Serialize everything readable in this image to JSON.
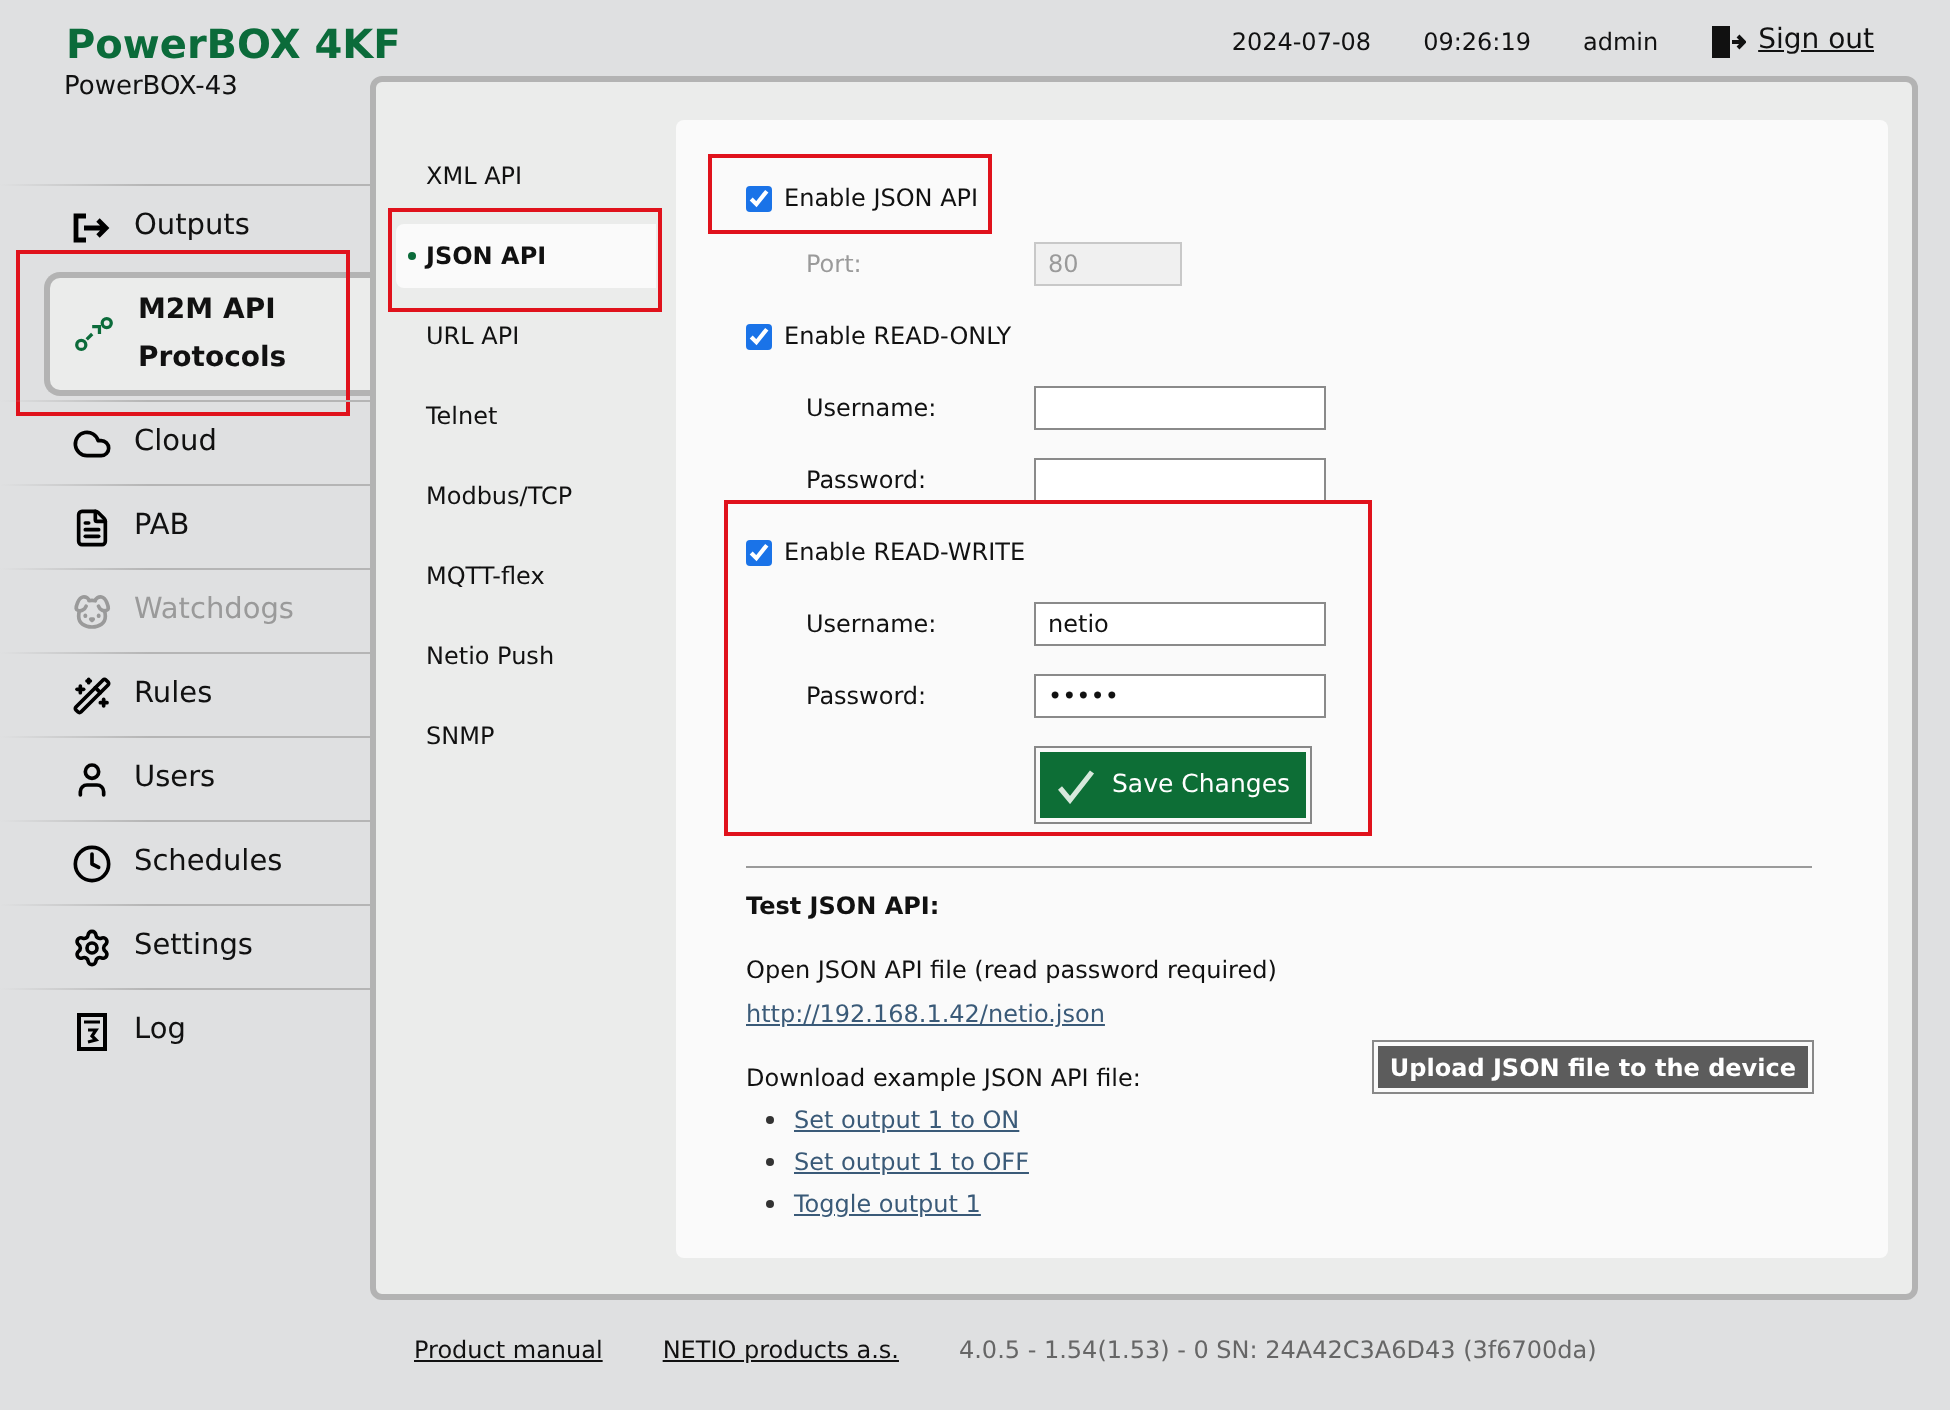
{
  "header": {
    "title": "PowerBOX 4KF",
    "subtitle": "PowerBOX-43",
    "date": "2024-07-08",
    "time": "09:26:19",
    "user": "admin",
    "sign_out": "Sign out"
  },
  "nav": [
    {
      "kind": "outputs",
      "label": "Outputs",
      "selected": false,
      "disabled": false,
      "highlighted": false
    },
    {
      "kind": "m2m",
      "label": "M2M API Protocols",
      "selected": true,
      "disabled": false,
      "highlighted": true
    },
    {
      "kind": "cloud",
      "label": "Cloud",
      "selected": false,
      "disabled": false,
      "highlighted": false
    },
    {
      "kind": "pab",
      "label": "PAB",
      "selected": false,
      "disabled": false,
      "highlighted": false
    },
    {
      "kind": "watchdogs",
      "label": "Watchdogs",
      "selected": false,
      "disabled": true,
      "highlighted": false
    },
    {
      "kind": "rules",
      "label": "Rules",
      "selected": false,
      "disabled": false,
      "highlighted": false
    },
    {
      "kind": "users",
      "label": "Users",
      "selected": false,
      "disabled": false,
      "highlighted": false
    },
    {
      "kind": "schedules",
      "label": "Schedules",
      "selected": false,
      "disabled": false,
      "highlighted": false
    },
    {
      "kind": "settings",
      "label": "Settings",
      "selected": false,
      "disabled": false,
      "highlighted": false
    },
    {
      "kind": "log",
      "label": "Log",
      "selected": false,
      "disabled": false,
      "highlighted": false
    }
  ],
  "subnav": [
    {
      "label": "XML API",
      "selected": false,
      "highlighted": false
    },
    {
      "label": "JSON API",
      "selected": true,
      "highlighted": true
    },
    {
      "label": "URL API",
      "selected": false,
      "highlighted": false
    },
    {
      "label": "Telnet",
      "selected": false,
      "highlighted": false
    },
    {
      "label": "Modbus/TCP",
      "selected": false,
      "highlighted": false
    },
    {
      "label": "MQTT-flex",
      "selected": false,
      "highlighted": false
    },
    {
      "label": "Netio Push",
      "selected": false,
      "highlighted": false
    },
    {
      "label": "SNMP",
      "selected": false,
      "highlighted": false
    }
  ],
  "enable_json": {
    "label": "Enable JSON API",
    "checked": true,
    "highlighted": true
  },
  "port": {
    "label": "Port:",
    "value": "80",
    "disabled": true
  },
  "read_only": {
    "label": "Enable READ-ONLY",
    "checked": true,
    "fields": [
      {
        "label": "Username:"
      },
      {
        "label": "Password:"
      }
    ]
  },
  "read_write": {
    "label": "Enable READ-WRITE",
    "checked": true,
    "highlighted": true,
    "fields": [
      {
        "label": "Username:",
        "value": "netio"
      },
      {
        "label": "Password:",
        "value": "•••••"
      }
    ],
    "save_button": "Save Changes"
  },
  "test": {
    "heading": "Test JSON API:",
    "open_text": "Open JSON API file (read password required)",
    "open_link": "http://192.168.1.42/netio.json",
    "download_text": "Download example JSON API file:",
    "download_links": [
      "Set output 1 to ON",
      "Set output 1 to OFF",
      "Toggle output 1"
    ],
    "upload_button": "Upload JSON file to the device"
  },
  "footer": {
    "links": [
      "Product manual",
      "NETIO products a.s."
    ],
    "version": "4.0.5 - 1.54(1.53) - 0 SN: 24A42C3A6D43 (3f6700da)"
  }
}
